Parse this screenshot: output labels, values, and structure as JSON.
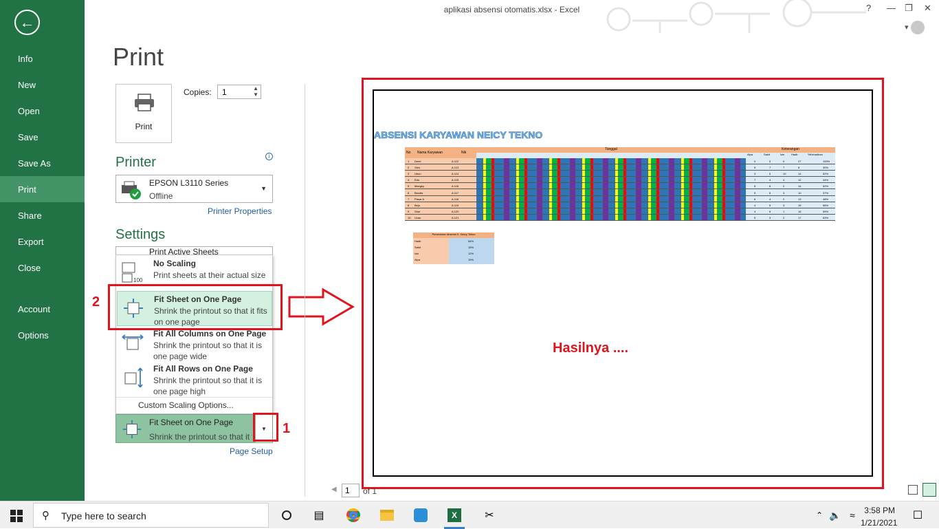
{
  "window": {
    "title": "aplikasi absensi otomatis.xlsx - Excel",
    "help": "?"
  },
  "nav": {
    "items": [
      {
        "label": "Info"
      },
      {
        "label": "New"
      },
      {
        "label": "Open"
      },
      {
        "label": "Save"
      },
      {
        "label": "Save As"
      },
      {
        "label": "Print"
      },
      {
        "label": "Share"
      },
      {
        "label": "Export"
      },
      {
        "label": "Close"
      },
      {
        "label": "Account"
      },
      {
        "label": "Options"
      }
    ]
  },
  "page_title": "Print",
  "print_button": "Print",
  "copies": {
    "label": "Copies:",
    "value": "1"
  },
  "printer": {
    "heading": "Printer",
    "name": "EPSON L3110 Series",
    "status": "Offline",
    "properties_link": "Printer Properties"
  },
  "settings": {
    "heading": "Settings",
    "first_option": "Print Active Sheets"
  },
  "scaling_menu": [
    {
      "title": "No Scaling",
      "desc": "Print sheets at their actual size"
    },
    {
      "title": "Fit Sheet on One Page",
      "desc": "Shrink the printout so that it fits on one page"
    },
    {
      "title": "Fit All Columns on One Page",
      "desc": "Shrink the printout so that it is one page wide"
    },
    {
      "title": "Fit All Rows on One Page",
      "desc": "Shrink the printout so that it is one page high"
    }
  ],
  "custom_scaling": "Custom Scaling Options...",
  "current_scaling": {
    "title": "Fit Sheet on One Page",
    "desc": "Shrink the printout so that it fits on one page"
  },
  "page_setup_link": "Page Setup",
  "annotations": {
    "step1": "1",
    "step2": "2",
    "result": "Hasilnya ...."
  },
  "preview": {
    "sheet_title": "ABSENSI KARYAWAN NEICY TEKNO",
    "headers": {
      "no": "No",
      "name": "Nama Karyawan",
      "nik": "Nik",
      "tanggal": "Tanggal",
      "keterangan": "Keterangan"
    },
    "summary_cols": [
      "Alpa",
      "Sakit",
      "Izin",
      "Hadir",
      "%Kehadiran"
    ],
    "rows": [
      {
        "no": "1",
        "name": "Demi",
        "nik": "A.112",
        "alpa": "0",
        "sakit": "0",
        "izin": "0",
        "hadir": "27",
        "pct": "100%"
      },
      {
        "no": "2",
        "name": "Gies",
        "nik": "A.113",
        "alpa": "5",
        "sakit": "7",
        "izin": "7",
        "hadir": "8",
        "pct": "30%"
      },
      {
        "no": "3",
        "name": "Ubun",
        "nik": "A.114",
        "alpa": "3",
        "sakit": "0",
        "izin": "10",
        "hadir": "14",
        "pct": "52%"
      },
      {
        "no": "4",
        "name": "Edo",
        "nik": "A.115",
        "alpa": "7",
        "sakit": "4",
        "izin": "4",
        "hadir": "12",
        "pct": "44%"
      },
      {
        "no": "5",
        "name": "Mangky",
        "nik": "A.116",
        "alpa": "5",
        "sakit": "6",
        "izin": "2",
        "hadir": "14",
        "pct": "52%"
      },
      {
        "no": "6",
        "name": "Bendis",
        "nik": "A.117",
        "alpa": "9",
        "sakit": "6",
        "izin": "3",
        "hadir": "10",
        "pct": "37%"
      },
      {
        "no": "7",
        "name": "Pasar A",
        "nik": "A.118",
        "alpa": "8",
        "sakit": "4",
        "izin": "2",
        "hadir": "13",
        "pct": "48%"
      },
      {
        "no": "8",
        "name": "Bejo",
        "nik": "A.119",
        "alpa": "4",
        "sakit": "5",
        "izin": "3",
        "hadir": "15",
        "pct": "56%"
      },
      {
        "no": "9",
        "name": "Gise",
        "nik": "A.120",
        "alpa": "4",
        "sakit": "6",
        "izin": "1",
        "hadir": "16",
        "pct": "59%"
      },
      {
        "no": "10",
        "name": "Ucan",
        "nik": "A.121",
        "alpa": "5",
        "sakit": "3",
        "izin": "2",
        "hadir": "17",
        "pct": "63%"
      }
    ],
    "pct_table": {
      "title": "Persentase Absensi K. Neicy Tekno",
      "rows": [
        {
          "label": "Hadir",
          "value": "54%"
        },
        {
          "label": "Sakit",
          "value": "15%"
        },
        {
          "label": "Izin",
          "value": "12%"
        },
        {
          "label": "Alpa",
          "value": "19%"
        }
      ]
    }
  },
  "pager": {
    "current": "1",
    "of": "of 1"
  },
  "taskbar": {
    "search_placeholder": "Type here to search",
    "time": "3:58 PM",
    "date": "1/21/2021"
  },
  "colors": {
    "excel_green": "#217346",
    "highlight": "#e0141e"
  }
}
